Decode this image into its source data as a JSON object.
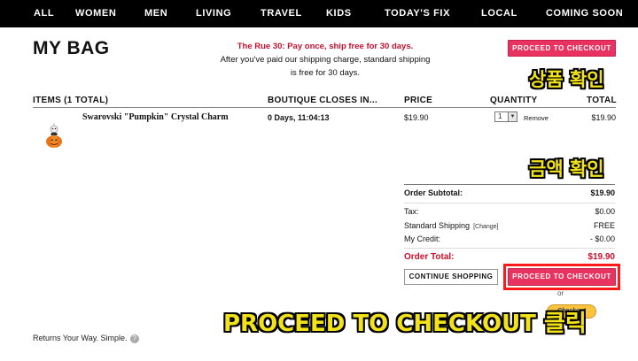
{
  "nav": {
    "items": [
      "ALL",
      "WOMEN",
      "MEN",
      "LIVING",
      "TRAVEL",
      "KIDS",
      "TODAY'S FIX",
      "LOCAL",
      "COMING SOON"
    ]
  },
  "page": {
    "title": "MY BAG",
    "promo_highlight": "The Rue 30: Pay once, ship free for 30 days.",
    "promo_line2": "After you've paid our shipping charge, standard shipping",
    "promo_line3": "is free for 30 days.",
    "checkout_button": "PROCEED TO CHECKOUT"
  },
  "cart": {
    "headers": {
      "items": "ITEMS (1 TOTAL)",
      "boutique": "BOUTIQUE CLOSES IN...",
      "price": "PRICE",
      "quantity": "QUANTITY",
      "total": "TOTAL"
    },
    "item": {
      "name": "Swarovski \"Pumpkin\" Crystal Charm",
      "closes_in": "0 Days, 11:04:13",
      "price": "$19.90",
      "quantity": "1",
      "remove": "Remove",
      "total": "$19.90"
    }
  },
  "summary": {
    "subtotal_label": "Order Subtotal:",
    "subtotal_value": "$19.90",
    "tax_label": "Tax:",
    "tax_value": "$0.00",
    "shipping_label": "Standard Shipping",
    "shipping_change": "[Change]",
    "shipping_value": "FREE",
    "credit_label": "My Credit:",
    "credit_value": "- $0.00",
    "total_label": "Order Total:",
    "total_value": "$19.90",
    "continue_button": "CONTINUE SHOPPING",
    "checkout_button": "PROCEED TO CHECKOUT",
    "or_text": "or",
    "paypal_text": "Checkout PayPal"
  },
  "footer": {
    "returns": "Returns Your Way. Simple."
  },
  "annotations": {
    "product_check": "상품 확인",
    "amount_check": "금액 확인",
    "click_instruction": "PROCEED TO CHECKOUT 클릭"
  },
  "colors": {
    "accent": "#e8325f",
    "promo_red": "#c8102e",
    "annotation_yellow": "#f2e21a",
    "highlight_frame": "#ff1a1a"
  }
}
